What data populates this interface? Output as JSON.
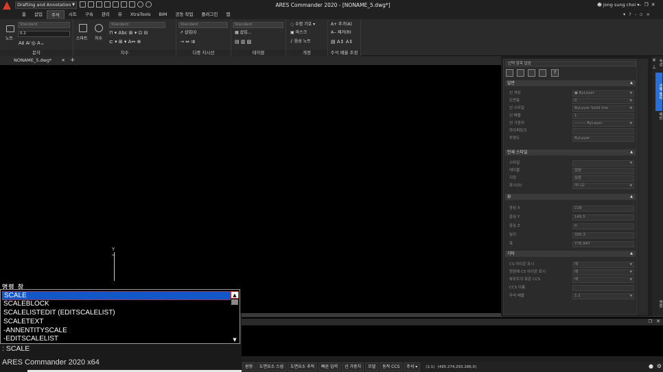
{
  "titlebar": {
    "workspace": "Drafting and Annotation",
    "title": "ARES Commander 2020 - [NONAME_5.dwg*]",
    "user": "jong sung choi"
  },
  "menu": {
    "items": [
      "홈",
      "삽입",
      "주석",
      "시트",
      "구속",
      "관리",
      "뷰",
      "XtraTools",
      "BIM",
      "공동 작업",
      "플러그인",
      "앱"
    ],
    "active": "주석"
  },
  "ribbon": {
    "text_group": {
      "label": "문자",
      "style": "Standard",
      "height": "0.2",
      "note": "노트"
    },
    "dim_group": {
      "label": "치수",
      "style": "Standard",
      "smart": "스마트",
      "dim": "치수"
    },
    "leader_group": {
      "label": "다중 지시선",
      "style": "Standard",
      "insert": "삽입(I)"
    },
    "table_group": {
      "label": "테이블",
      "style": "Standard",
      "insert": "삽입..."
    },
    "markup_group": {
      "label": "개정",
      "revcloud": "수정 기호",
      "mask": "마스크",
      "voice": "음성 노트"
    },
    "scale_group": {
      "label": "주석 배율 조정",
      "add": "추가(A)",
      "remove": "제거(R)"
    }
  },
  "doc_tab": {
    "name": "NONAME_5.dwg*"
  },
  "ucs": {
    "y_label": "Y"
  },
  "properties": {
    "selection": "선택 항목 없음",
    "general": {
      "title": "일반",
      "rows": [
        {
          "k": "선 색상",
          "v": "● ByLayer"
        },
        {
          "k": "도면층",
          "v": "0"
        },
        {
          "k": "선 스타일",
          "v": "ByLayer     Solid line"
        },
        {
          "k": "선 배율",
          "v": "1"
        },
        {
          "k": "선 가중치",
          "v": "——— ByLayer"
        },
        {
          "k": "하이퍼링크",
          "v": ""
        },
        {
          "k": "투명도",
          "v": "ByLayer"
        }
      ]
    },
    "plot": {
      "title": "인쇄 스타일",
      "rows": [
        {
          "k": "스타일",
          "v": ""
        },
        {
          "k": "테이블",
          "v": "없음"
        },
        {
          "k": "지정",
          "v": "없음"
        },
        {
          "k": "표시(D)",
          "v": "아니오"
        }
      ]
    },
    "view": {
      "title": "뷰",
      "rows": [
        {
          "k": "중심 X",
          "v": "218"
        },
        {
          "k": "중심 Y",
          "v": "149.5"
        },
        {
          "k": "중심 Z",
          "v": "0"
        },
        {
          "k": "높이",
          "v": "395.3"
        },
        {
          "k": "폭",
          "v": "776.947"
        }
      ]
    },
    "misc": {
      "title": "기타",
      "rows": [
        {
          "k": "CS 아이콘 표시",
          "v": "예"
        },
        {
          "k": "원점에 CS 아이콘 표시",
          "v": "예"
        },
        {
          "k": "뷰포트의 표준 CCS",
          "v": "예"
        },
        {
          "k": "CCS 이름",
          "v": ""
        },
        {
          "k": "주석 배율",
          "v": "1:1"
        }
      ]
    }
  },
  "side_tabs": [
    "속성",
    "선택 필터",
    "명령",
    "패턴"
  ],
  "command": {
    "history_label": "명령 창",
    "suggestions": [
      "SCALE",
      "SCALEBLOCK",
      "SCALELISTEDIT (EDITSCALELIST)",
      "SCALETEXT",
      "-ANNENTITYSCALE",
      "-EDITSCALELIST"
    ],
    "selected": "SCALE",
    "input": ": SCALE"
  },
  "status": {
    "app": "ARES Commander 2020 x64",
    "buttons": [
      "원형",
      "도면요소 스냅",
      "도면요소 추적",
      "빠른 입력",
      "선 가중치",
      "모델",
      "동적 CCS",
      "주석"
    ],
    "scale": "(1:1)",
    "coords": "(495.274,293.286,0)"
  }
}
